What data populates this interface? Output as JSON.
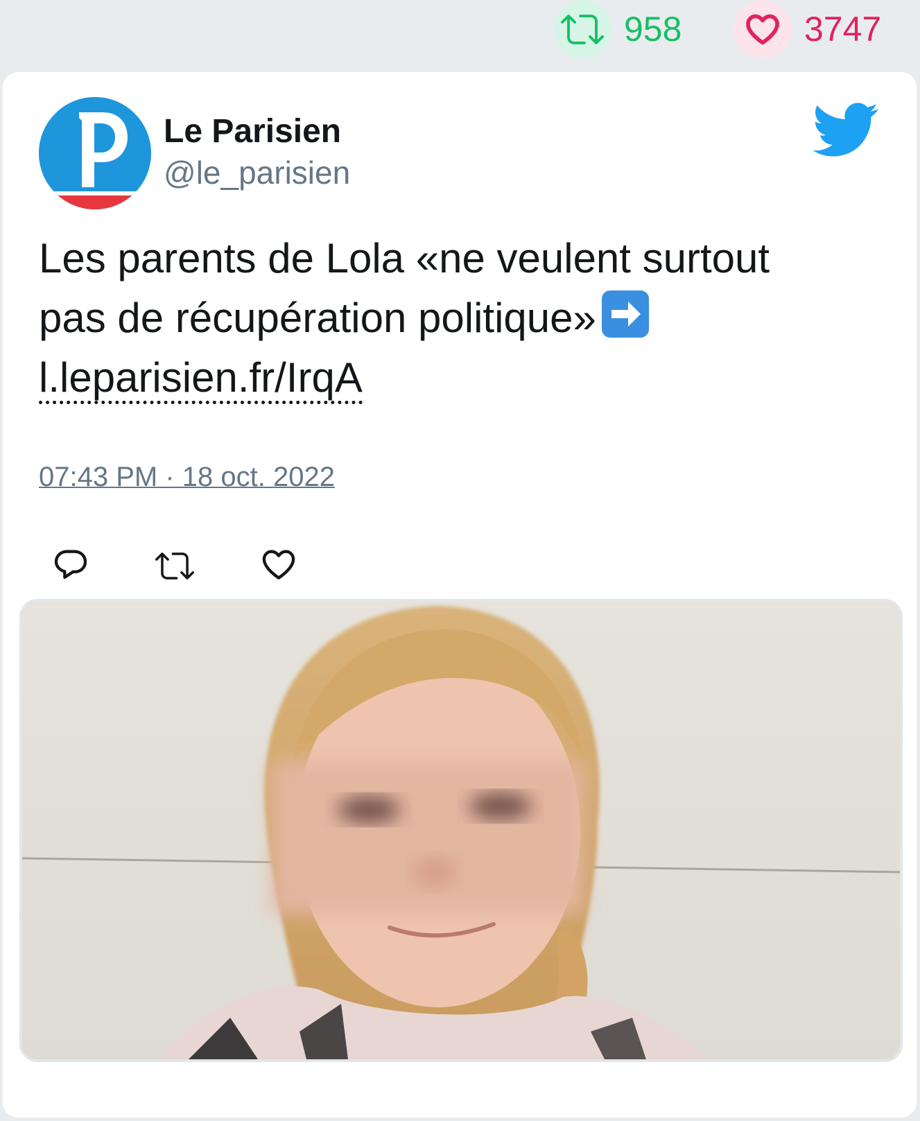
{
  "stats": {
    "retweets": "958",
    "likes": "3747"
  },
  "tweet": {
    "display_name": "Le Parisien",
    "handle": "@le_parisien",
    "text_line1": "Les parents de Lola «ne veulent surtout",
    "text_line2": "pas de récupération politique»",
    "link": "l.leparisien.fr/IrqA",
    "timestamp": "07:43 PM · 18 oct. 2022"
  },
  "icons": {
    "retweet": "retweet-icon",
    "like": "heart-icon",
    "reply": "reply-icon",
    "brand": "twitter-bird-icon",
    "emoji": "right-arrow-emoji"
  },
  "colors": {
    "retweet": "#17bf63",
    "like": "#e0245e",
    "brand": "#1da1f2",
    "avatar_bg": "#1e96dc",
    "text": "#14171a",
    "muted": "#657786"
  }
}
